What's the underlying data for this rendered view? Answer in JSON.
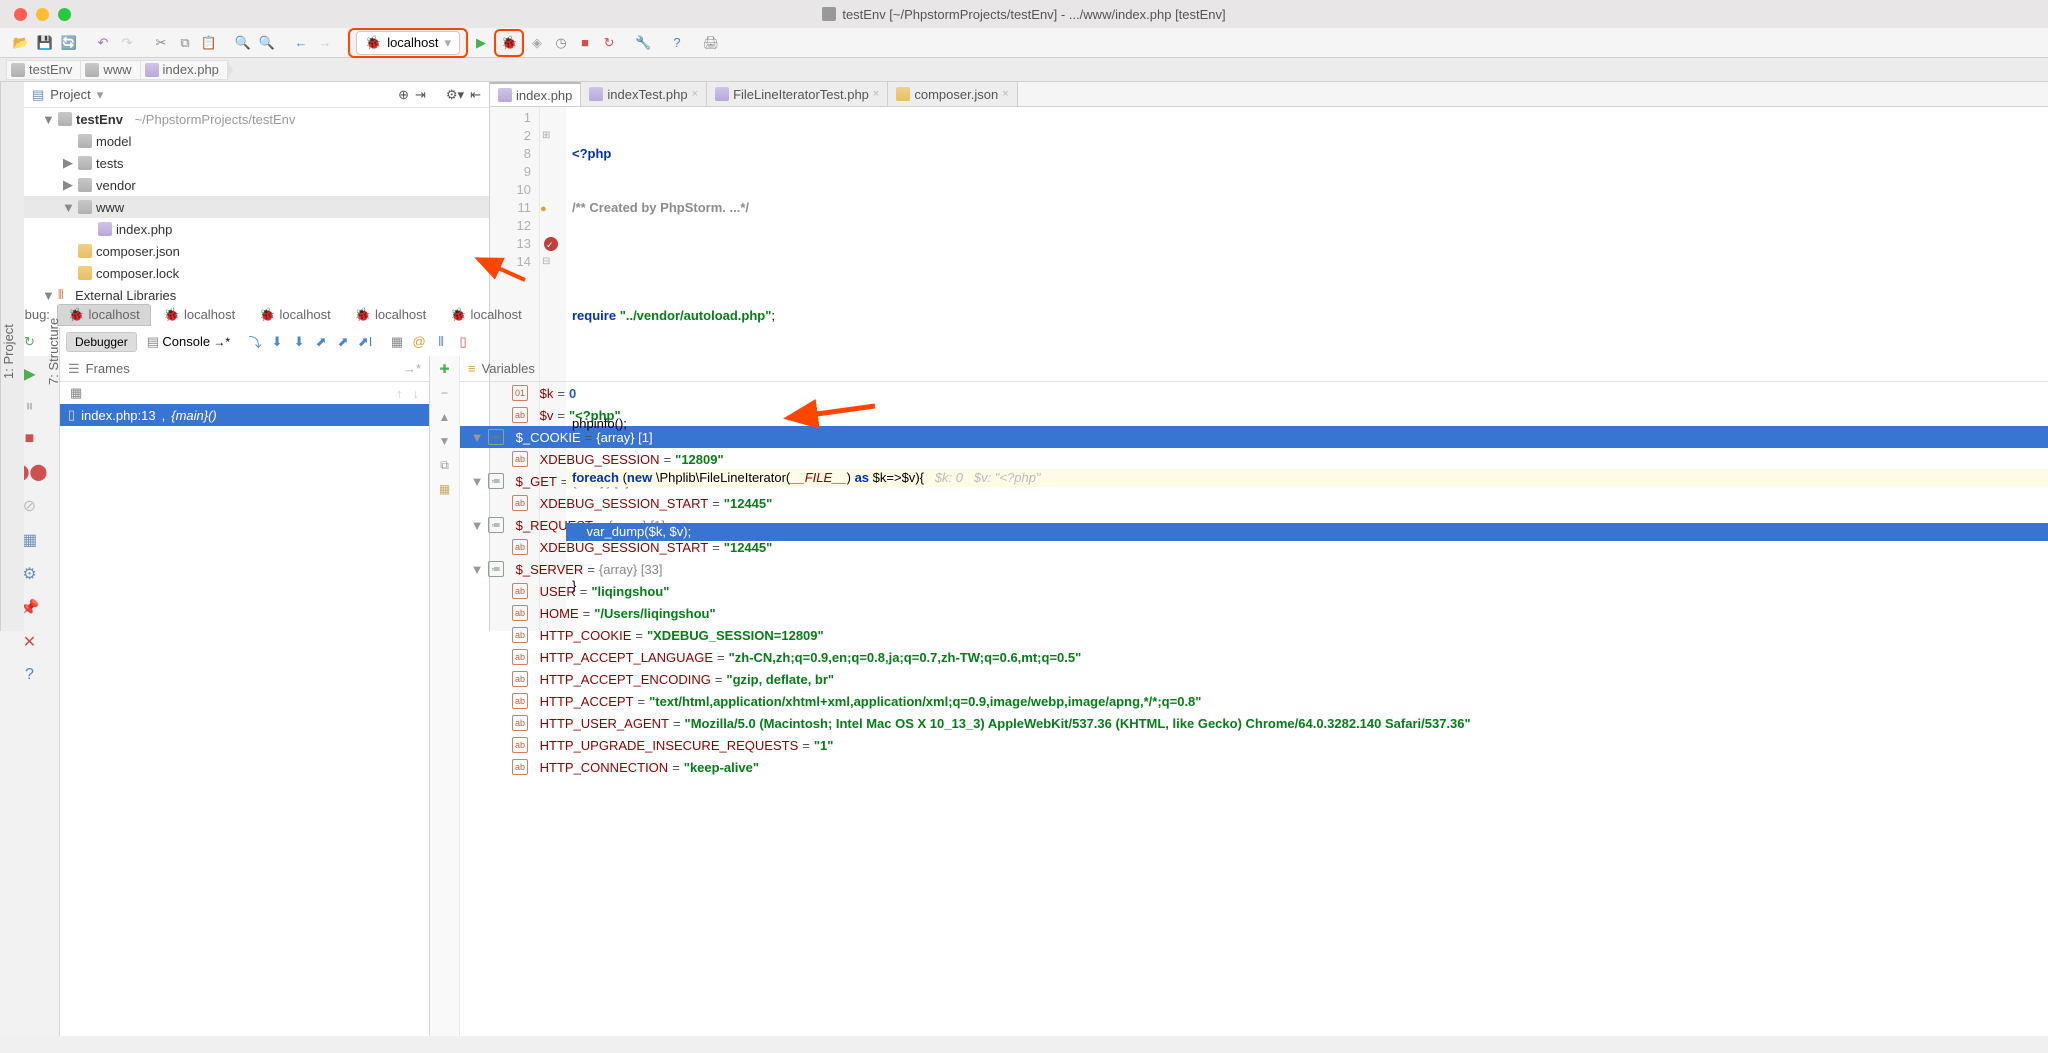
{
  "window": {
    "title": "testEnv [~/PhpstormProjects/testEnv] - .../www/index.php [testEnv]"
  },
  "toolbar": {
    "run_config": "localhost"
  },
  "breadcrumbs": [
    "testEnv",
    "www",
    "index.php"
  ],
  "project": {
    "header": "Project",
    "root": {
      "name": "testEnv",
      "path": "~/PhpstormProjects/testEnv"
    },
    "folders": [
      "model",
      "tests",
      "vendor",
      "www"
    ],
    "www_files": [
      "index.php"
    ],
    "root_files": [
      "composer.json",
      "composer.lock"
    ],
    "ext": "External Libraries"
  },
  "editor_tabs": [
    {
      "name": "index.php",
      "active": true
    },
    {
      "name": "indexTest.php",
      "close": true
    },
    {
      "name": "FileLineIteratorTest.php",
      "close": true
    },
    {
      "name": "composer.json",
      "close": true
    }
  ],
  "gutter_lines": [
    "1",
    "2",
    "8",
    "9",
    "10",
    "11",
    "12",
    "13",
    "14"
  ],
  "code": {
    "l1": "<?php",
    "l2_a": "/** ",
    "l2_b": "Created by PhpStorm. ",
    "l2_c": "...*/",
    "l9_a": "require ",
    "l9_b": "\"../vendor/autoload.php\"",
    "l9_c": ";",
    "l11": "phpinfo();",
    "l12_a": "foreach ",
    "l12_b": "(",
    "l12_c": "new ",
    "l12_d": "\\Phplib\\FileLineIterator",
    "l12_e": "(",
    "l12_f": "__FILE__",
    "l12_g": ")",
    "l12_h": " as ",
    "l12_i": "$k=>$v",
    "l12_j": "){",
    "l12_hint": "   $k: 0   $v: \"<?php\"",
    "l13_a": "    var_dump",
    "l13_b": "($k, $v);",
    "l14": "}"
  },
  "side_tabs": {
    "project": "1: Project",
    "structure": "7: Structure"
  },
  "debug": {
    "label": "Debug:",
    "sessions": [
      "localhost",
      "localhost",
      "localhost",
      "localhost",
      "localhost"
    ],
    "sub_debugger": "Debugger",
    "sub_console": "Console",
    "frames_hdr": "Frames",
    "vars_hdr": "Variables",
    "frame": {
      "file": "index.php:13",
      "func": "{main}()"
    },
    "vars": {
      "k": {
        "name": "$k",
        "val": "0"
      },
      "v": {
        "name": "$v",
        "val": "\"<?php\""
      },
      "cookie": {
        "name": "$_COOKIE",
        "type": "{array} [1]",
        "items": [
          {
            "name": "XDEBUG_SESSION",
            "val": "\"12809\""
          }
        ]
      },
      "get": {
        "name": "$_GET",
        "type": "{array} [1]",
        "items": [
          {
            "name": "XDEBUG_SESSION_START",
            "val": "\"12445\""
          }
        ]
      },
      "request": {
        "name": "$_REQUEST",
        "type": "{array} [1]",
        "items": [
          {
            "name": "XDEBUG_SESSION_START",
            "val": "\"12445\""
          }
        ]
      },
      "server": {
        "name": "$_SERVER",
        "type": "{array} [33]",
        "items": [
          {
            "name": "USER",
            "val": "\"liqingshou\""
          },
          {
            "name": "HOME",
            "val": "\"/Users/liqingshou\""
          },
          {
            "name": "HTTP_COOKIE",
            "val": "\"XDEBUG_SESSION=12809\""
          },
          {
            "name": "HTTP_ACCEPT_LANGUAGE",
            "val": "\"zh-CN,zh;q=0.9,en;q=0.8,ja;q=0.7,zh-TW;q=0.6,mt;q=0.5\""
          },
          {
            "name": "HTTP_ACCEPT_ENCODING",
            "val": "\"gzip, deflate, br\""
          },
          {
            "name": "HTTP_ACCEPT",
            "val": "\"text/html,application/xhtml+xml,application/xml;q=0.9,image/webp,image/apng,*/*;q=0.8\""
          },
          {
            "name": "HTTP_USER_AGENT",
            "val": "\"Mozilla/5.0 (Macintosh; Intel Mac OS X 10_13_3) AppleWebKit/537.36 (KHTML, like Gecko) Chrome/64.0.3282.140 Safari/537.36\""
          },
          {
            "name": "HTTP_UPGRADE_INSECURE_REQUESTS",
            "val": "\"1\""
          },
          {
            "name": "HTTP_CONNECTION",
            "val": "\"keep-alive\""
          }
        ]
      }
    }
  }
}
